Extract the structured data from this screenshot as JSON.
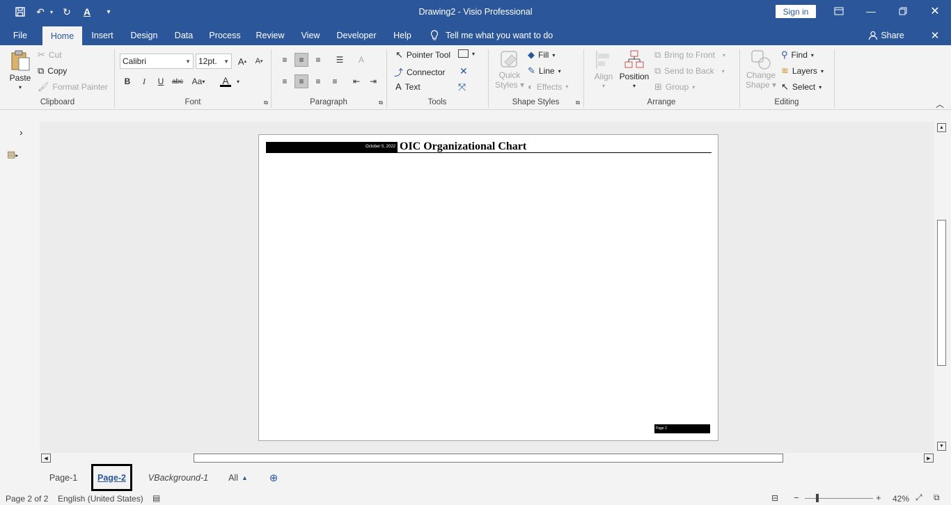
{
  "window": {
    "title": "Drawing2  -  Visio Professional",
    "signin": "Sign in"
  },
  "tabs": [
    "File",
    "Home",
    "Insert",
    "Design",
    "Data",
    "Process",
    "Review",
    "View",
    "Developer",
    "Help"
  ],
  "tell_me": "Tell me what you want to do",
  "share": "Share",
  "ribbon": {
    "clipboard": {
      "label": "Clipboard",
      "paste": "Paste",
      "cut": "Cut",
      "copy": "Copy",
      "format_painter": "Format Painter"
    },
    "font": {
      "label": "Font",
      "family": "Calibri",
      "size": "12pt."
    },
    "paragraph": {
      "label": "Paragraph"
    },
    "tools": {
      "label": "Tools",
      "pointer": "Pointer Tool",
      "connector": "Connector",
      "text": "Text"
    },
    "shape_styles": {
      "label": "Shape Styles",
      "quick_styles_1": "Quick",
      "quick_styles_2": "Styles",
      "fill": "Fill",
      "line": "Line",
      "effects": "Effects"
    },
    "arrange": {
      "label": "Arrange",
      "align": "Align",
      "position": "Position",
      "bring_front": "Bring to Front",
      "send_back": "Send to Back",
      "group": "Group"
    },
    "editing": {
      "label": "Editing",
      "change_shape_1": "Change",
      "change_shape_2": "Shape",
      "find": "Find",
      "layers": "Layers",
      "select": "Select"
    }
  },
  "page": {
    "date": "October 5, 2022",
    "title": "OIC Organizational Chart",
    "footer": "Page 2"
  },
  "page_tabs": [
    "Page-1",
    "Page-2",
    "VBackground-1",
    "All"
  ],
  "status": {
    "page_of": "Page 2 of 2",
    "language": "English (United States)",
    "zoom": "42%"
  }
}
